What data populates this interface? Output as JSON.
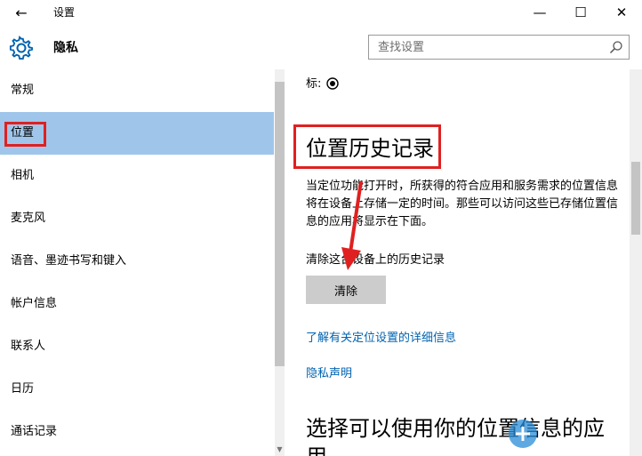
{
  "window": {
    "title": "设置",
    "back_glyph": "←",
    "minimize_glyph": "—",
    "maximize_glyph": "☐",
    "close_glyph": "✕"
  },
  "header": {
    "title": "隐私",
    "icon": "gear-icon"
  },
  "search": {
    "placeholder": "查找设置",
    "value": "",
    "icon": "search-icon"
  },
  "sidebar": {
    "items": [
      {
        "label": "常规",
        "selected": false
      },
      {
        "label": "位置",
        "selected": true
      },
      {
        "label": "相机",
        "selected": false
      },
      {
        "label": "麦克风",
        "selected": false
      },
      {
        "label": "语音、墨迹书写和键入",
        "selected": false
      },
      {
        "label": "帐户信息",
        "selected": false
      },
      {
        "label": "联系人",
        "selected": false
      },
      {
        "label": "日历",
        "selected": false
      },
      {
        "label": "通话记录",
        "selected": false
      }
    ]
  },
  "content": {
    "partial_label": "标:",
    "section_title": "位置历史记录",
    "description": "当定位功能打开时，所获得的符合应用和服务需求的位置信息将在设备上存储一定的时间。那些可以访问这些已存储位置信息的应用将显示在下面。",
    "clear_label": "清除这台设备上的历史记录",
    "clear_button": "清除",
    "link_learn_more": "了解有关定位设置的详细信息",
    "link_privacy": "隐私声明",
    "section2_title": "选择可以使用你的位置信息的应用"
  },
  "colors": {
    "selected_bg": "#9fc6ea",
    "link": "#0063b1",
    "highlight": "#e02020",
    "button_bg": "#cccccc",
    "accent_icon": "#0063b1"
  }
}
